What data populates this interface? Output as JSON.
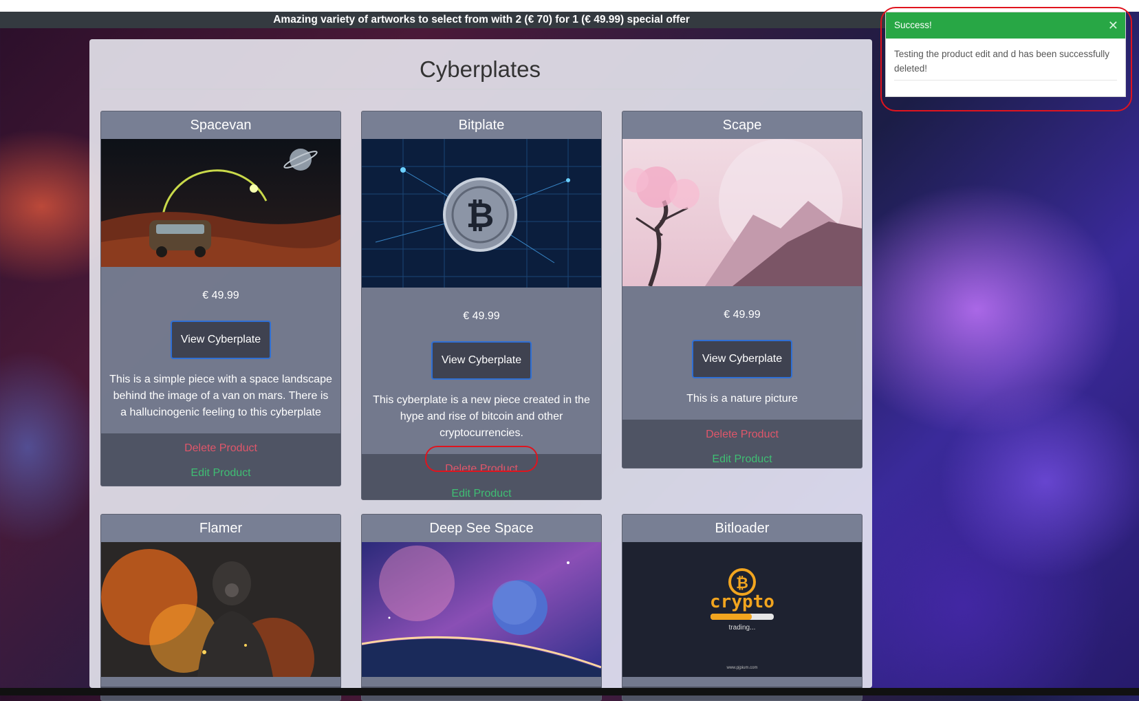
{
  "banner": {
    "text": "Amazing variety of artworks to select from with 2 (€ 70) for 1 (€ 49.99) special offer"
  },
  "page": {
    "title": "Cyberplates"
  },
  "products": [
    {
      "title": "Spacevan",
      "image": "van-on-mars-landscape",
      "price": "€ 49.99",
      "view_label": "View Cyberplate",
      "description": "This is a simple piece with a space landscape behind the image of a van on mars. There is a hallucinogenic feeling to this cyberplate",
      "delete_label": "Delete Product",
      "edit_label": "Edit Product"
    },
    {
      "title": "Bitplate",
      "image": "bitcoin-coin-network",
      "price": "€ 49.99",
      "view_label": "View Cyberplate",
      "description": "This cyberplate is a new piece created in the hype and rise of bitcoin and other cryptocurrencies.",
      "delete_label": "Delete Product",
      "edit_label": "Edit Product"
    },
    {
      "title": "Scape",
      "image": "pink-blossom-tree-mountains",
      "price": "€ 49.99",
      "view_label": "View Cyberplate",
      "description": "This is a nature picture",
      "delete_label": "Delete Product",
      "edit_label": "Edit Product"
    },
    {
      "title": "Flamer",
      "image": "soldier-in-flames"
    },
    {
      "title": "Deep See Space",
      "image": "planet-in-nebula"
    },
    {
      "title": "Bitloader",
      "image": "crypto-trading-logo",
      "logo_text": "crypto",
      "loading_text": "trading...",
      "site_text": "www.pjpium.com"
    }
  ],
  "toast": {
    "title": "Success!",
    "message": "Testing the product edit and d has been successfully deleted!",
    "color": "#28a745"
  },
  "annotation_color": "#e0141e"
}
